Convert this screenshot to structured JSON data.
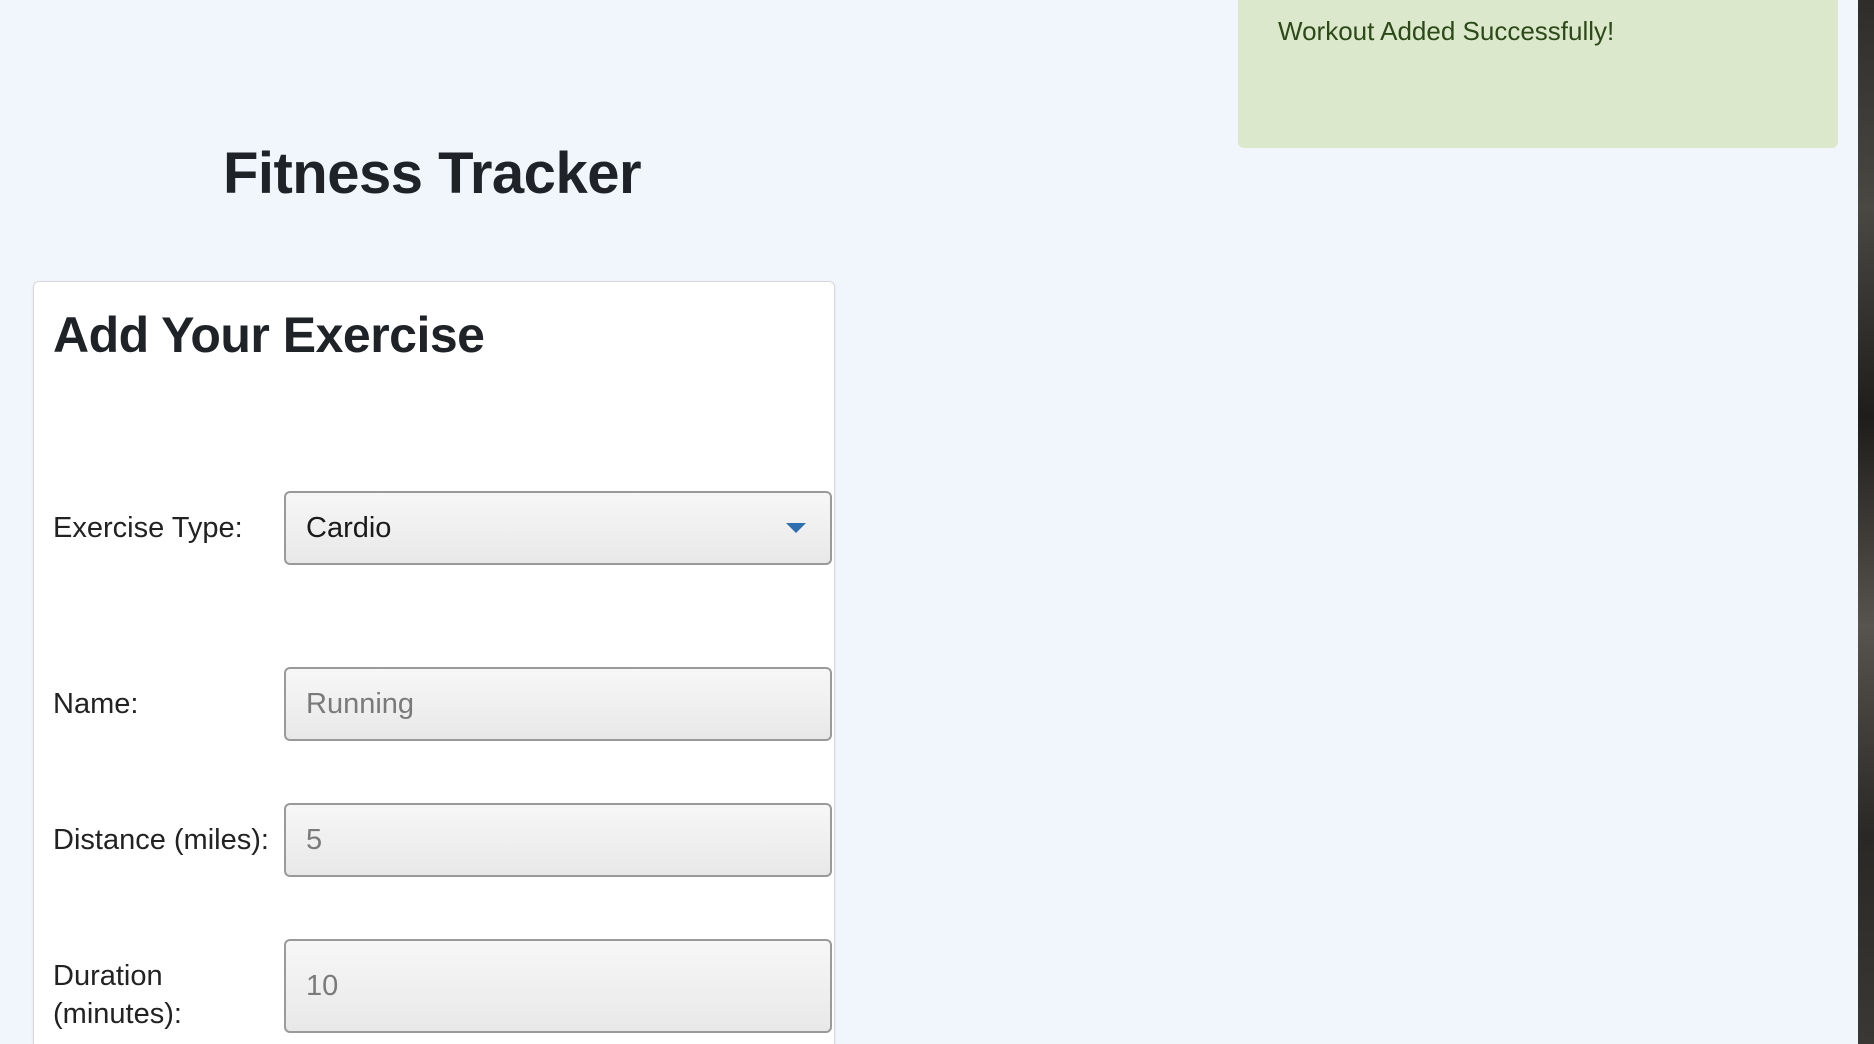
{
  "toast": {
    "message": "Workout Added Successfully!"
  },
  "app": {
    "title": "Fitness Tracker"
  },
  "form": {
    "title": "Add Your Exercise",
    "exercise_type": {
      "label": "Exercise Type:",
      "selected": "Cardio"
    },
    "name": {
      "label": "Name:",
      "placeholder": "Running"
    },
    "distance": {
      "label": "Distance (miles):",
      "placeholder": "5"
    },
    "duration": {
      "label": "Duration (minutes):",
      "placeholder": "10"
    }
  },
  "colors": {
    "background": "#f1f6fd",
    "toast_bg": "#dce8cc",
    "toast_text": "#2c4a18",
    "caret": "#2e6fb0"
  },
  "icons": {
    "select_caret": "chevron-down-icon"
  }
}
